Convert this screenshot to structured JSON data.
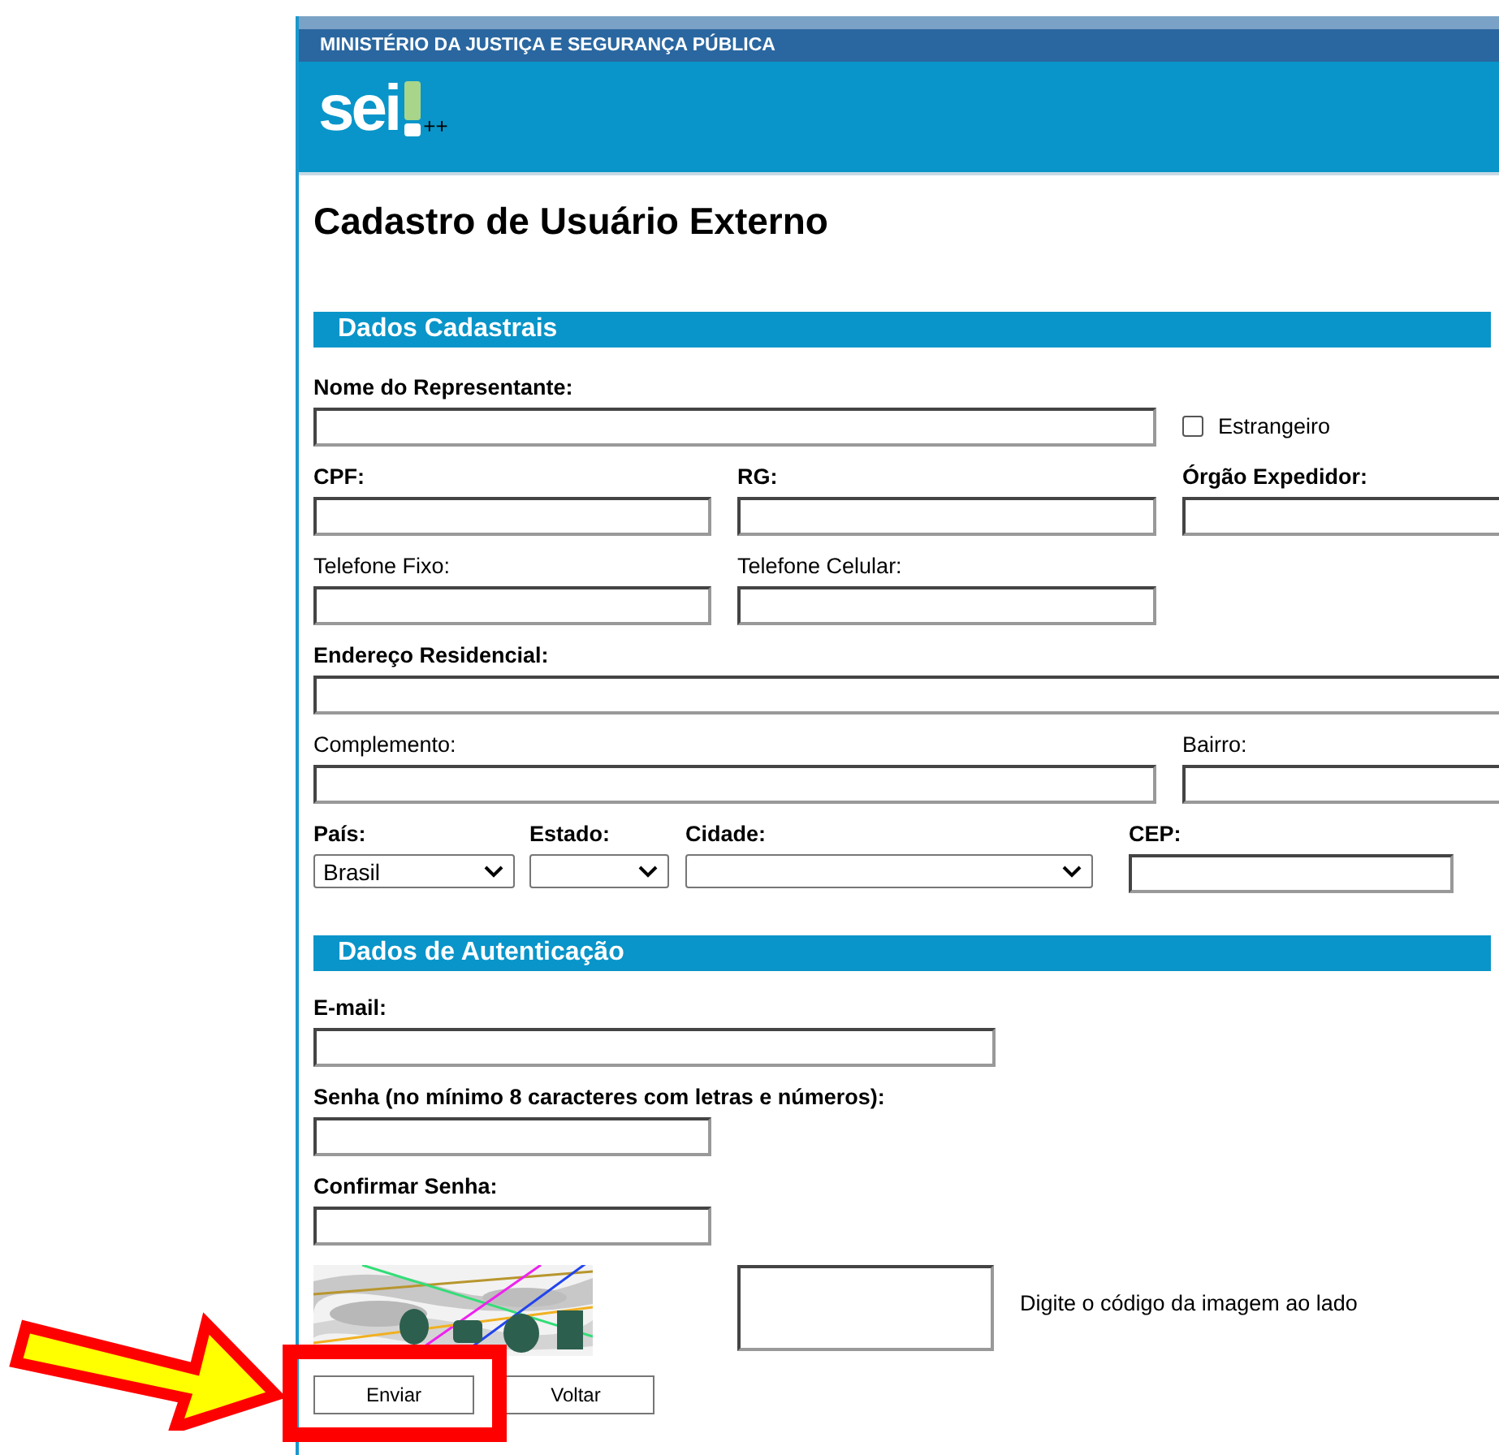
{
  "header": {
    "ministry": "MINISTÉRIO DA JUSTIÇA E SEGURANÇA PÚBLICA",
    "logo": "sei",
    "logo_suffix": "++"
  },
  "title": "Cadastro de Usuário Externo",
  "dados_cadastrais": {
    "title": "Dados Cadastrais",
    "nome": {
      "label": "Nome do Representante:",
      "required": true
    },
    "estrangeiro": {
      "label": "Estrangeiro",
      "checked": false
    },
    "cpf": {
      "label": "CPF:",
      "required": true
    },
    "rg": {
      "label": "RG:",
      "required": true
    },
    "orgao": {
      "label": "Órgão Expedidor:",
      "required": true
    },
    "telefone_fixo": {
      "label": "Telefone Fixo:",
      "required": false
    },
    "telefone_celular": {
      "label": "Telefone Celular:",
      "required": false
    },
    "endereco": {
      "label": "Endereço Residencial:",
      "required": true
    },
    "complemento": {
      "label": "Complemento:",
      "required": false
    },
    "bairro": {
      "label": "Bairro:",
      "required": false
    },
    "pais": {
      "label": "País:",
      "required": true,
      "value": "Brasil"
    },
    "estado": {
      "label": "Estado:",
      "required": true
    },
    "cidade": {
      "label": "Cidade:",
      "required": true
    },
    "cep": {
      "label": "CEP:",
      "required": true
    }
  },
  "autenticacao": {
    "title": "Dados de Autenticação",
    "email": {
      "label": "E-mail:",
      "required": true
    },
    "senha": {
      "label": "Senha (no mínimo 8 caracteres com letras e números):",
      "required": true
    },
    "confirmar": {
      "label": "Confirmar Senha:",
      "required": true
    }
  },
  "captcha": {
    "kind": "picture",
    "hint": "Digite o código da imagem ao lado"
  },
  "buttons": [
    {
      "label": "Enviar",
      "highlighted": true
    },
    {
      "label": "Voltar",
      "highlighted": false
    }
  ]
}
